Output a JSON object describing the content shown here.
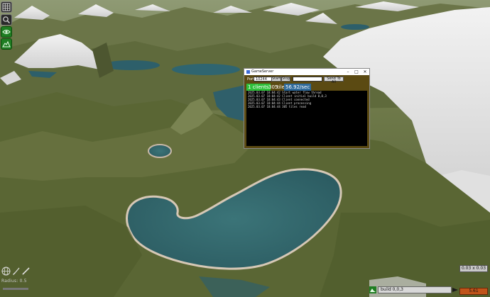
{
  "server_window": {
    "title": "GameServer",
    "minimize": "–",
    "maximize": "□",
    "close": "✕",
    "port_label": "Port",
    "port_value": "10244",
    "start_label": "Start",
    "stop_label": "Stop",
    "send_label": "Send To All",
    "clients": "1 clients",
    "tiles_count": "305",
    "tiles_label": "tiles",
    "rate": "56.92/sec",
    "log": [
      "2025.03.07 18:04:42 Start water flow thread",
      "2025.03.07 18:04:42 Client initial build 0,0,3",
      "2025.03.07 18:04:43 Client connected",
      "2025.03.07 18:04:44 Client processing",
      "2025.03.07 18:04:44 305 tiles read"
    ]
  },
  "bottom_left": {
    "radius_label": "Radius: 0.5"
  },
  "status_bar": {
    "build_text": "build 0,0,3"
  },
  "coords": {
    "position": "0.03 x 0.03",
    "zoom": "5.61"
  },
  "icons": {
    "grid": "grid-icon",
    "search": "search-layers-icon",
    "eye": "view-icon",
    "terrain": "terrain-icon",
    "globe": "globe-icon",
    "brush": "brush-icon",
    "pencil": "pencil-icon",
    "app": "app-icon"
  },
  "colors": {
    "terrain_green": "#5c6a3c",
    "water": "#2f5f6a",
    "snow": "#e6e6e6",
    "window_bg": "#5b4a12",
    "clients_badge": "#2ec03a",
    "rate_badge": "#2f6a9a",
    "zoom_box": "#c0541a"
  }
}
